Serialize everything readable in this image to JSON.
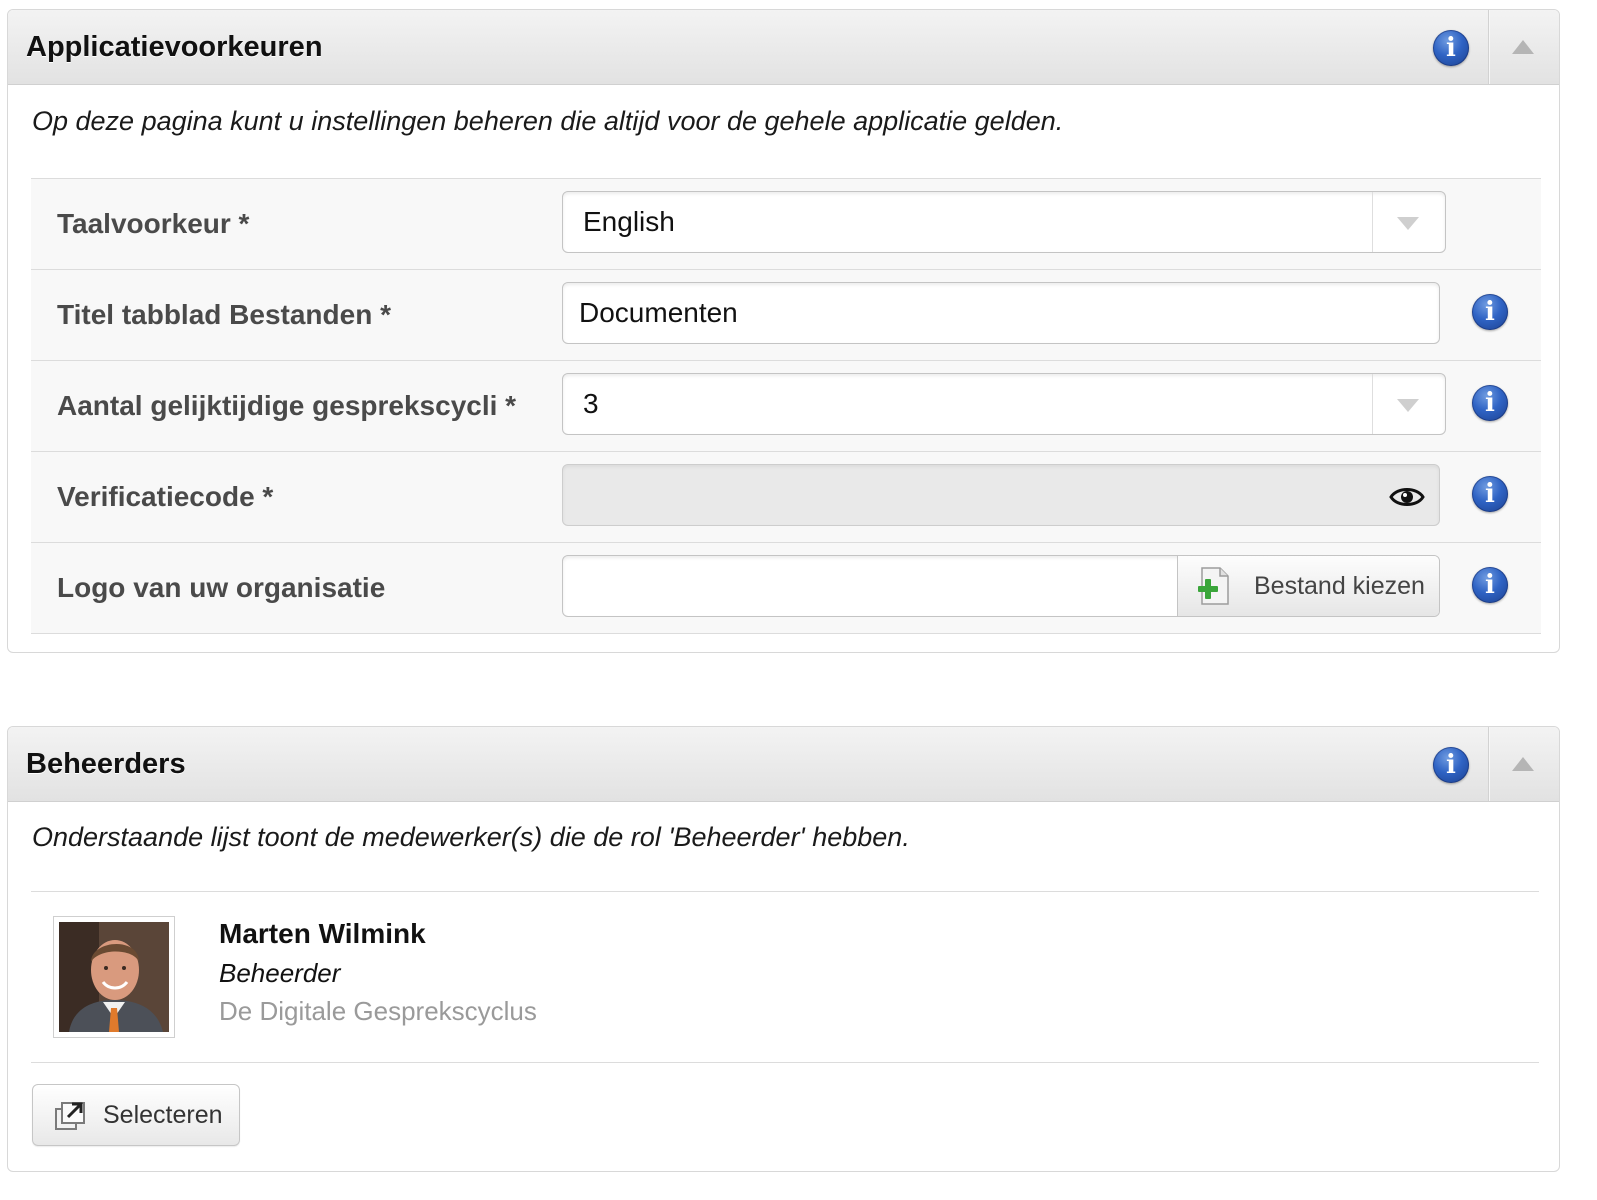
{
  "preferences": {
    "title": "Applicatievoorkeuren",
    "intro": "Op deze pagina kunt u instellingen beheren die altijd voor de gehele applicatie gelden.",
    "info_glyph": "i",
    "fields": {
      "language": {
        "label": "Taalvoorkeur *",
        "value": "English"
      },
      "files_tab_title": {
        "label": "Titel tabblad Bestanden *",
        "value": "Documenten"
      },
      "concurrent_cycles": {
        "label": "Aantal gelijktijdige gesprekscycli *",
        "value": "3"
      },
      "verification_code": {
        "label": "Verificatiecode *",
        "value": ""
      },
      "logo": {
        "label": "Logo van uw organisatie",
        "button": "Bestand kiezen"
      }
    }
  },
  "admins": {
    "title": "Beheerders",
    "intro": "Onderstaande lijst toont de medewerker(s) die de rol 'Beheerder' hebben.",
    "info_glyph": "i",
    "list": [
      {
        "name": "Marten Wilmink",
        "role": "Beheerder",
        "organization": "De Digitale Gesprekscyclus"
      }
    ],
    "select_button": "Selecteren"
  },
  "colors": {
    "info_blue": "#2f63c4",
    "header_bg": "#e8e8e8",
    "row_bg": "#f8f8f8",
    "label_grey": "#4a4a4a",
    "org_grey": "#9a9a9a"
  },
  "icons": [
    "info-icon",
    "collapse-icon",
    "dropdown-caret-icon",
    "eye-icon",
    "add-file-icon",
    "popout-icon"
  ]
}
